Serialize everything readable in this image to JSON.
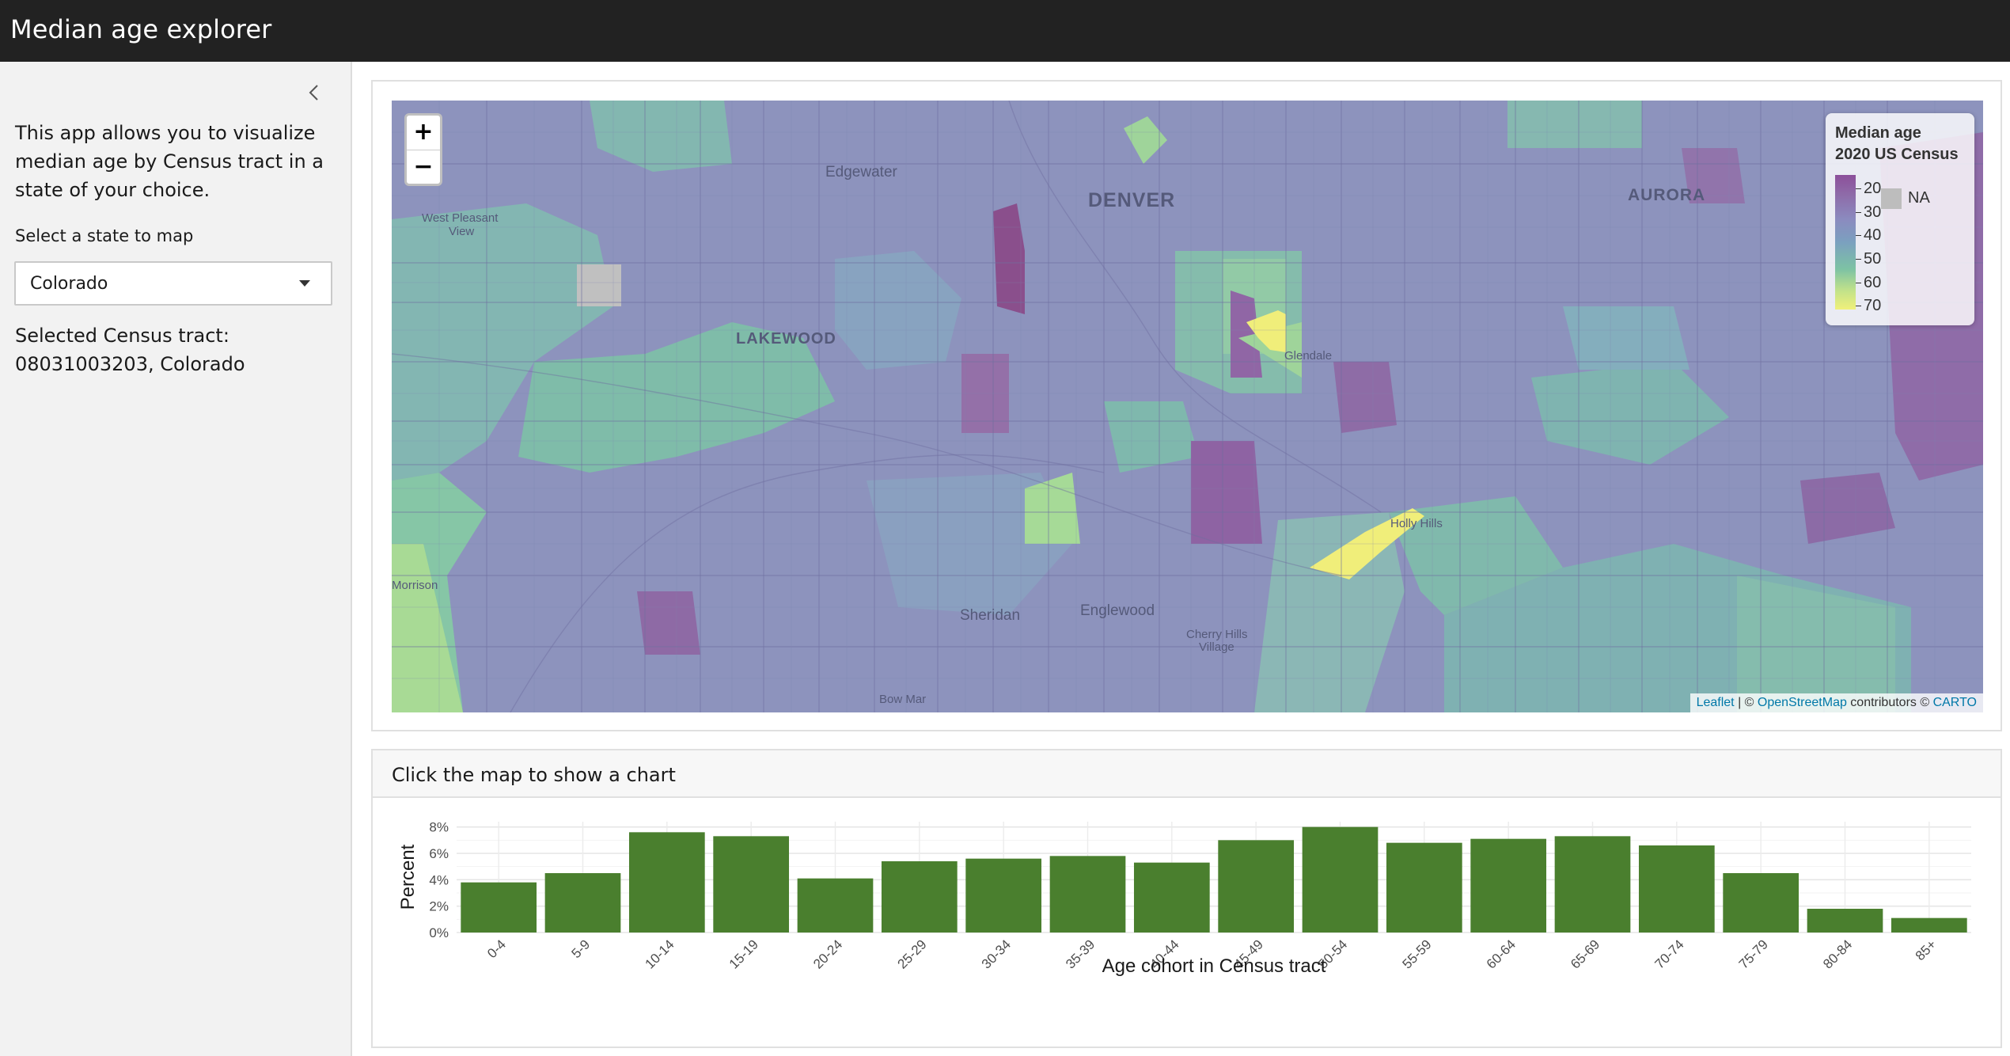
{
  "app": {
    "title": "Median age explorer"
  },
  "sidebar": {
    "intro": "This app allows you to visualize median age by Census tract in a state of your choice.",
    "select_label": "Select a state to map",
    "select_value": "Colorado",
    "selected_tract_label": "Selected Census tract:",
    "selected_tract_value": "08031003203, Colorado"
  },
  "map": {
    "zoom_in": "+",
    "zoom_out": "−",
    "legend": {
      "title_line1": "Median age",
      "title_line2": "2020 US Census",
      "ticks": [
        "20",
        "30",
        "40",
        "50",
        "60",
        "70"
      ],
      "na_label": "NA"
    },
    "place_labels": [
      "Edgewater",
      "DENVER",
      "AURORA",
      "West Pleasant",
      "View",
      "LAKEWOOD",
      "Glendale",
      "Holly Hills",
      "Morrison",
      "Sheridan",
      "Englewood",
      "Cherry Hills",
      "Village",
      "Bow Mar"
    ],
    "attribution": {
      "leaflet": "Leaflet",
      "sep1": " | © ",
      "osm": "OpenStreetMap",
      "contrib": " contributors © ",
      "carto": "CARTO"
    }
  },
  "chart_card": {
    "header": "Click the map to show a chart"
  },
  "chart_data": {
    "type": "bar",
    "categories": [
      "0-4",
      "5-9",
      "10-14",
      "15-19",
      "20-24",
      "25-29",
      "30-34",
      "35-39",
      "40-44",
      "45-49",
      "50-54",
      "55-59",
      "60-64",
      "65-69",
      "70-74",
      "75-79",
      "80-84",
      "85+"
    ],
    "values": [
      3.8,
      4.5,
      7.6,
      7.3,
      4.1,
      5.4,
      5.6,
      5.8,
      5.3,
      7.0,
      8.0,
      6.8,
      7.1,
      7.3,
      6.6,
      4.5,
      1.8,
      1.1
    ],
    "title": "",
    "xlabel": "Age cohort in Census tract",
    "ylabel": "Percent",
    "ylim": [
      0,
      8.4
    ],
    "yticks": [
      "0%",
      "2%",
      "4%",
      "6%",
      "8%"
    ],
    "bar_color": "#4a7f2e",
    "grid": true
  },
  "colors": {
    "navbar": "#222222",
    "sidebar": "#f2f2f2",
    "bar": "#4a7f2e",
    "link": "#0078a8"
  }
}
